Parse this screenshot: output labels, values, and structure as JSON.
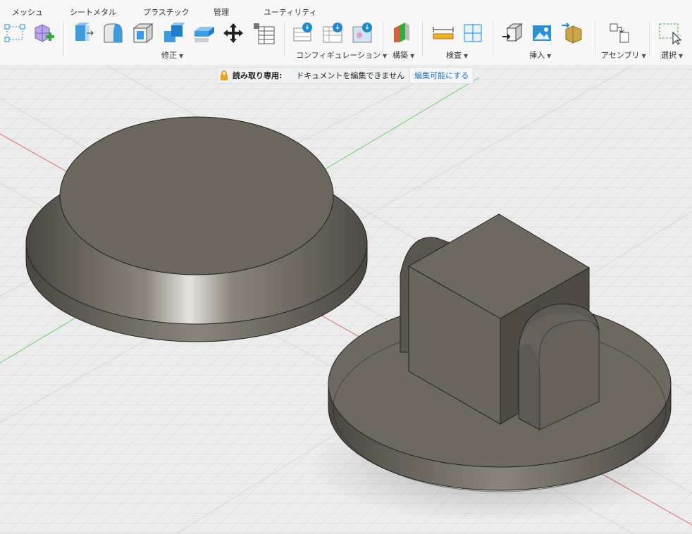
{
  "tabs": [
    "メッシュ",
    "シートメタル",
    "プラスチック",
    "管理",
    "ユーティリティ"
  ],
  "groups": {
    "modify": "修正",
    "configuration": "コンフィギュレーション",
    "construct": "構築",
    "inspect": "検査",
    "insert": "挿入",
    "assemble": "アセンブリ",
    "select": "選択"
  },
  "banner": {
    "readonly_label": "読み取り専用:",
    "message": "ドキュメントを編集できません",
    "enable_edit": "編集可能にする"
  },
  "icons": [
    "sketch-points-icon",
    "create-mesh-icon",
    "press-pull-icon",
    "fillet-icon",
    "shell-icon",
    "combine-icon",
    "offset-face-icon",
    "move-icon",
    "change-parameters-icon",
    "config-table-icon",
    "config-rows-icon",
    "config-theme-icon",
    "offset-plane-icon",
    "midplane-icon",
    "measure-icon",
    "section-analysis-icon",
    "insert-derive-icon",
    "insert-image-icon",
    "insert-mesh-icon",
    "joint-icon",
    "select-window-icon"
  ],
  "colors": {
    "accent_blue": "#1f88d6",
    "link": "#1f6fc0",
    "lock": "#f0a020",
    "body_dark": "#6c675c",
    "axis_red": "#e06a6a",
    "axis_green": "#6ad06a"
  }
}
